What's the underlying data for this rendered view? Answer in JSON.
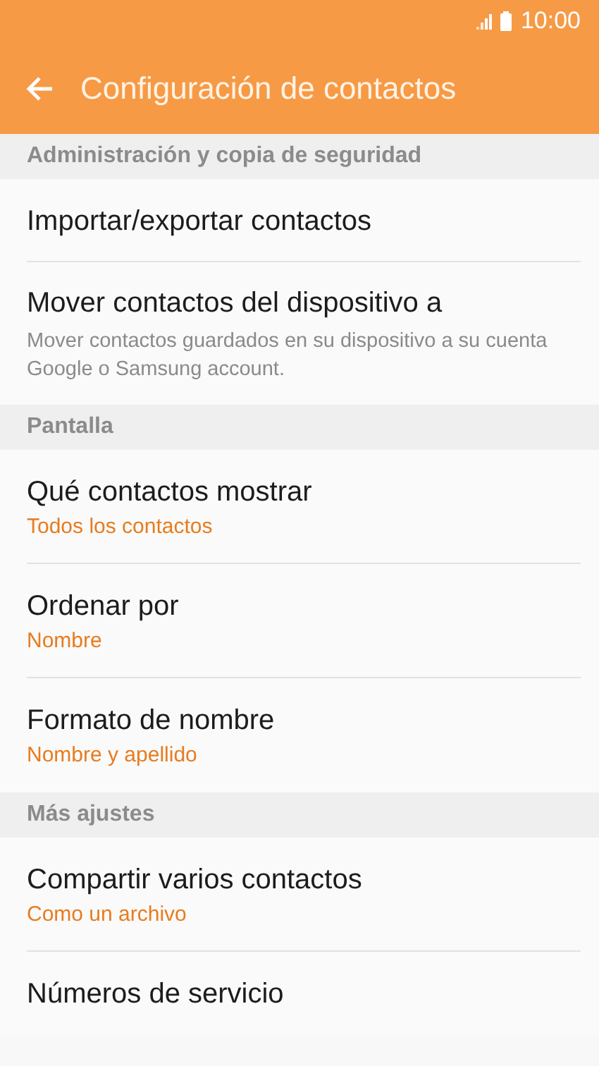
{
  "status_bar": {
    "time": "10:00"
  },
  "header": {
    "title": "Configuración de contactos"
  },
  "sections": [
    {
      "title": "Administración y copia de seguridad",
      "items": [
        {
          "kind": "plain",
          "title": "Importar/exportar contactos"
        },
        {
          "kind": "description",
          "title": "Mover contactos del dispositivo a",
          "subtitle": "Mover contactos guardados en su dispositivo a su cuenta Google o Samsung account."
        }
      ]
    },
    {
      "title": "Pantalla",
      "items": [
        {
          "kind": "value",
          "title": "Qué contactos mostrar",
          "subtitle": "Todos los contactos"
        },
        {
          "kind": "value",
          "title": "Ordenar por",
          "subtitle": "Nombre"
        },
        {
          "kind": "value",
          "title": "Formato de nombre",
          "subtitle": "Nombre y apellido"
        }
      ]
    },
    {
      "title": "Más ajustes",
      "items": [
        {
          "kind": "value",
          "title": "Compartir varios contactos",
          "subtitle": "Como un archivo"
        },
        {
          "kind": "plain",
          "title": "Números de servicio"
        }
      ]
    }
  ]
}
